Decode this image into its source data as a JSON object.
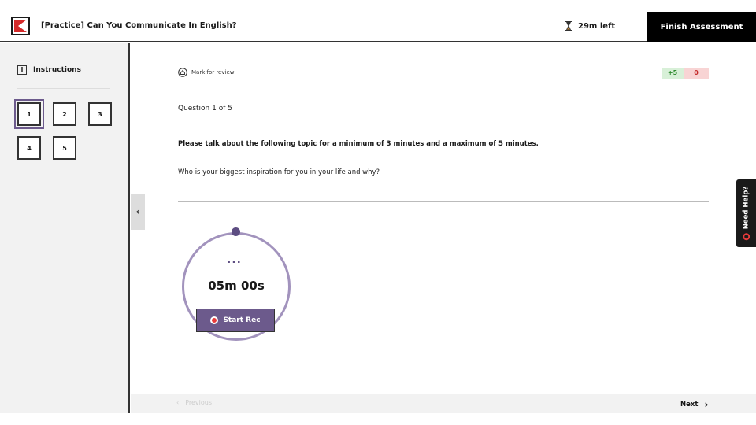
{
  "header": {
    "title": "[Practice] Can You Communicate In English?",
    "time_left": "29m left",
    "finish_label": "Finish Assessment",
    "logo_icon": "brand-logo-icon",
    "timer_icon": "hourglass-icon"
  },
  "sidebar": {
    "instructions_label": "Instructions",
    "questions": [
      "1",
      "2",
      "3",
      "4",
      "5"
    ],
    "active_question": "1"
  },
  "main": {
    "mark_for_review": "Mark for review",
    "score_positive": "+5",
    "score_negative": "0",
    "question_count": "Question 1 of 5",
    "prompt": "Please talk about the following topic for a minimum of 3 minutes and a maximum of 5 minutes.",
    "question": "Who is your biggest inspiration for you in your life and why?"
  },
  "recorder": {
    "dots": "...",
    "time": "05m 00s",
    "button_label": "Start Rec"
  },
  "footer": {
    "previous_label": "Previous",
    "next_label": "Next"
  },
  "help": {
    "label": "Need Help?"
  },
  "colors": {
    "accent": "#6c5a8c",
    "ring": "#a293bd",
    "record": "#e83b3b",
    "positive": "#2e8a2e",
    "negative": "#c42b2b"
  }
}
